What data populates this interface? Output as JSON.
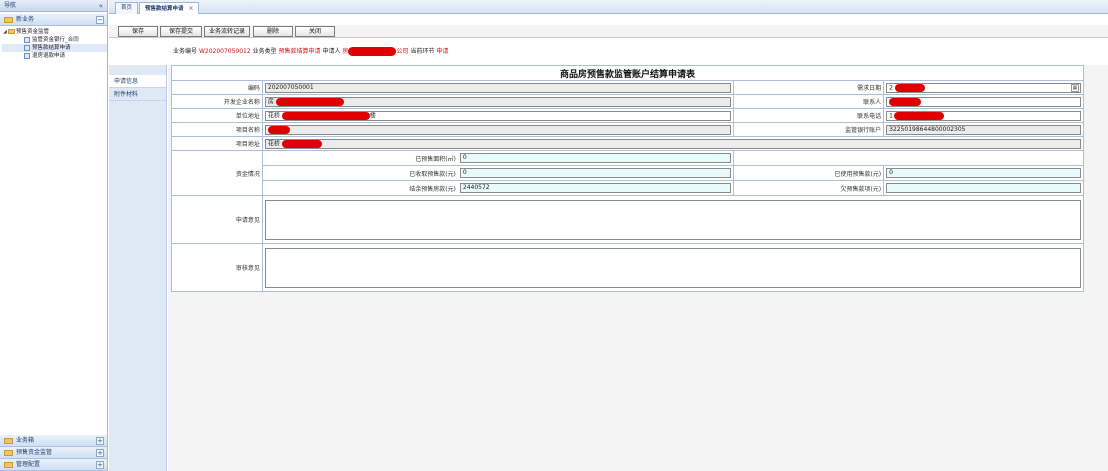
{
  "nav": {
    "title": "导航",
    "collapse_label": "«",
    "top_accordion": {
      "label": "新业务",
      "toggle": "−"
    },
    "tree": [
      {
        "label": "预售资金监管",
        "level": 0
      },
      {
        "label": "监管资金银行_合同",
        "level": 1
      },
      {
        "label": "预售款结算申请",
        "level": 1
      },
      {
        "label": "退房退款申请",
        "level": 1
      }
    ],
    "bottom_accordions": [
      {
        "label": "业务箱",
        "toggle": "+"
      },
      {
        "label": "预售资金监管",
        "toggle": "+"
      },
      {
        "label": "管理配置",
        "toggle": "+"
      }
    ]
  },
  "tabs": [
    {
      "label": "首页"
    },
    {
      "label": "预售款结算申请",
      "close": "×"
    }
  ],
  "toolbar": {
    "buttons": [
      "保存",
      "保存提交",
      "业务流转记录",
      "删除",
      "关闭"
    ]
  },
  "info": {
    "biz_no_label": "业务编号",
    "biz_no": "W202007050012",
    "biz_type_label": "业务类型",
    "biz_type": "预售款结算申请",
    "applicant_label": "申请人",
    "applicant": "房",
    "applicant_suffix": "公司",
    "step_label": "当前环节",
    "step": "申请"
  },
  "side_tabs": [
    "申请信息",
    "附件材料"
  ],
  "form": {
    "title": "商品房预售款监管账户结算申请表",
    "code_label": "编码",
    "code": "202007050001",
    "date_label": "需求日期",
    "date": "2",
    "developer_label": "开发企业名称",
    "developer": "房",
    "contact_label": "联系人",
    "contact": "",
    "address_label": "单位地址",
    "address": "花桥",
    "address_suffix": "楼",
    "phone_label": "联系电话",
    "phone": "1",
    "project_label": "项目名称",
    "project": "",
    "bank_account_label": "监管银行账户",
    "bank_account": "32250198644800002305",
    "project_address_label": "项目地址",
    "project_address": "花桥",
    "funds_label": "资金情况",
    "presold_area_label": "已预售面积(㎡)",
    "presold_area": "0",
    "received_label": "已收取预售款(元)",
    "received": "0",
    "used_label": "已使用预售款(元)",
    "used": "0",
    "remaining_label": "结余预售房款(元)",
    "remaining": "2440572",
    "owed_label": "欠预售款项(元)",
    "owed": "",
    "apply_opinion_label": "申请意见",
    "review_opinion_label": "审核意见"
  },
  "colors": {
    "redaction": "#e00000",
    "accent_red": "#d01010",
    "nav_blue": "#1f3f73"
  }
}
